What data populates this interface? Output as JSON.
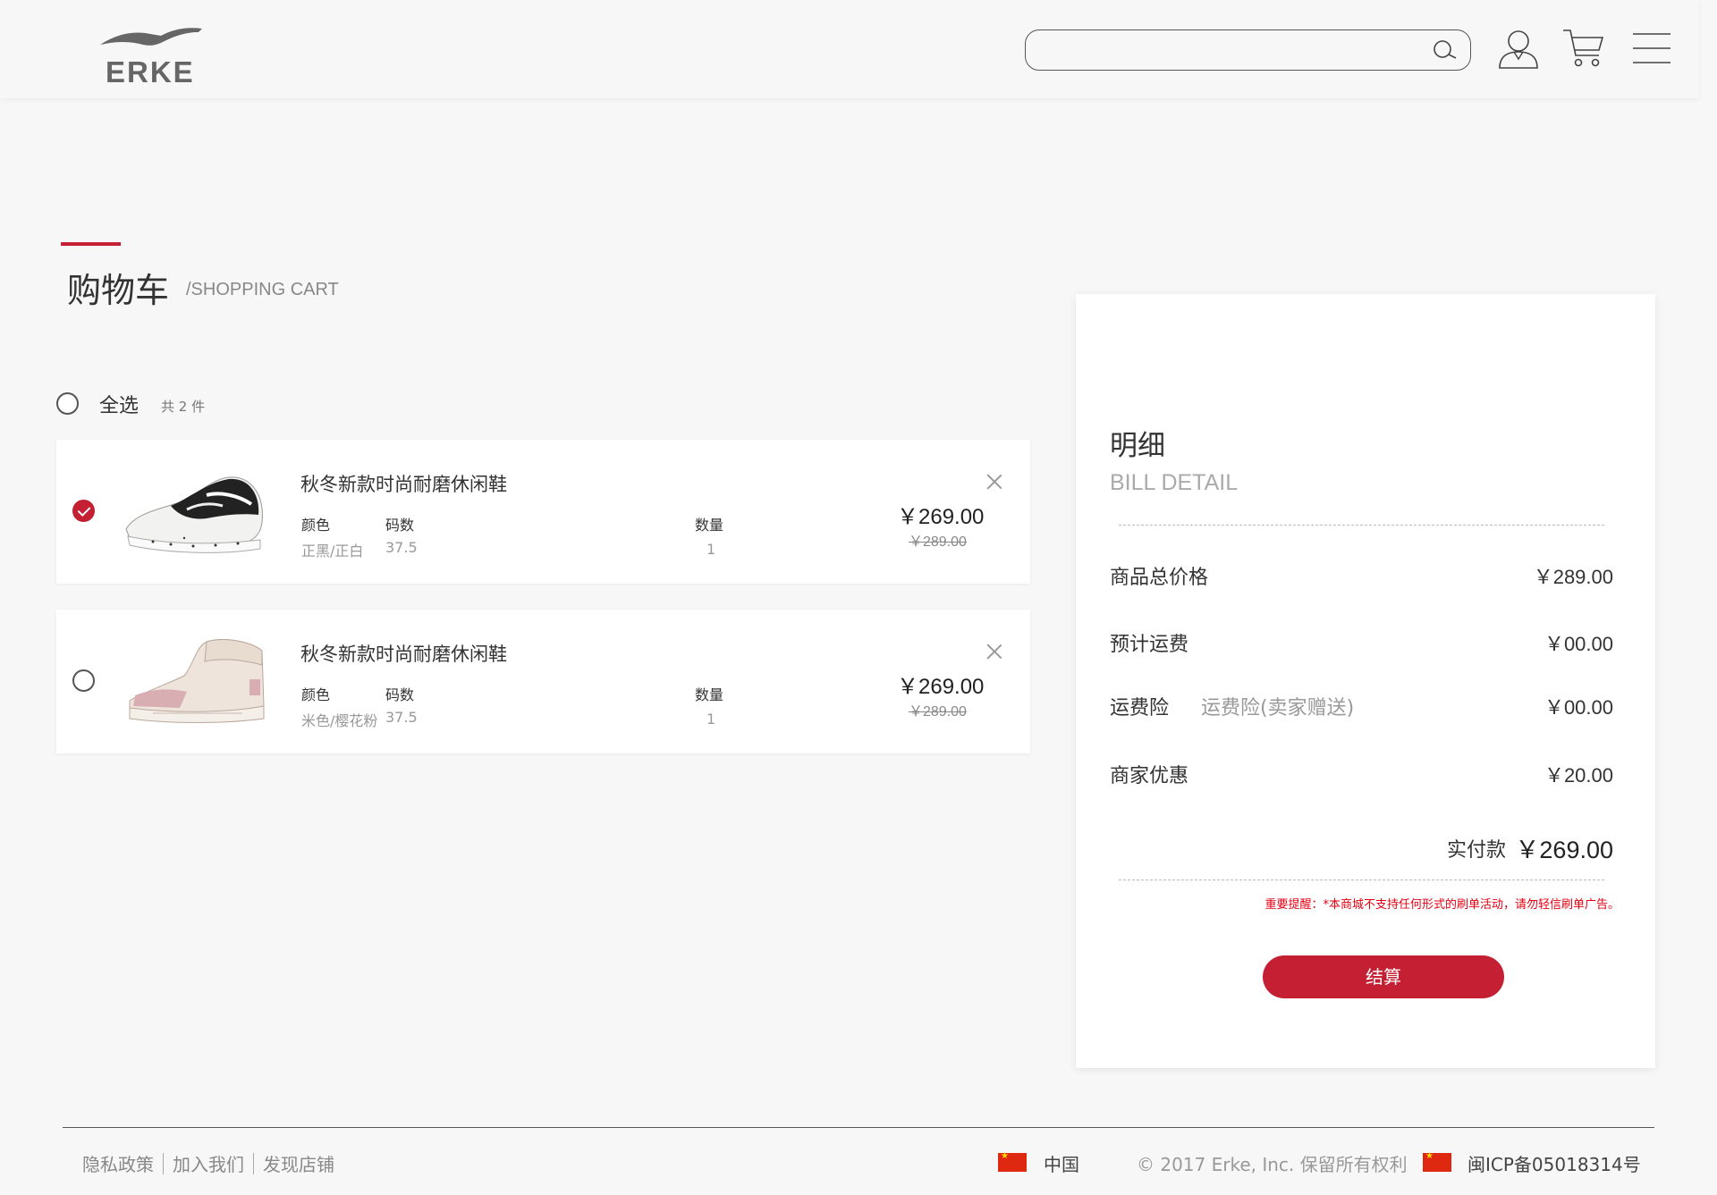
{
  "header": {
    "logo_text": "ERKE",
    "search_placeholder": ""
  },
  "page_title": {
    "cn": "购物车",
    "en": "/SHOPPING CART"
  },
  "select_all": {
    "label": "全选",
    "count": "共 2 件"
  },
  "cart_items": [
    {
      "name": "秋冬新款时尚耐磨休闲鞋",
      "color_label": "颜色",
      "size_label": "码数",
      "qty_label": "数量",
      "color": "正黑/正白",
      "size": "37.5",
      "qty": "1",
      "price": "￥269.00",
      "old_price": "￥289.00",
      "checked": true
    },
    {
      "name": "秋冬新款时尚耐磨休闲鞋",
      "color_label": "颜色",
      "size_label": "码数",
      "qty_label": "数量",
      "color": "米色/樱花粉",
      "size": "37.5",
      "qty": "1",
      "price": "￥269.00",
      "old_price": "￥289.00",
      "checked": false
    }
  ],
  "bill": {
    "title": "明细",
    "title_en": "BILL DETAIL",
    "rows": [
      {
        "label": "商品总价格",
        "sub": "",
        "value": "￥289.00"
      },
      {
        "label": "预计运费",
        "sub": "",
        "value": "￥00.00"
      },
      {
        "label": "运费险",
        "sub": "运费险(卖家赠送)",
        "value": "￥00.00"
      },
      {
        "label": "商家优惠",
        "sub": "",
        "value": "￥20.00"
      }
    ],
    "pay_label": "实付款",
    "pay_value": "￥269.00",
    "notice": "重要提醒：*本商城不支持任何形式的刷单活动，请勿轻信刷单广告。",
    "checkout_label": "结算"
  },
  "footer": {
    "links": [
      "隐私政策",
      "加入我们",
      "发现店铺"
    ],
    "country": "中国",
    "copyright": "© 2017 Erke, Inc. 保留所有权利",
    "icp": "闽ICP备05018314号"
  },
  "colors": {
    "accent": "#c41f32",
    "notice": "#e60012",
    "background": "#f7f7f7"
  }
}
